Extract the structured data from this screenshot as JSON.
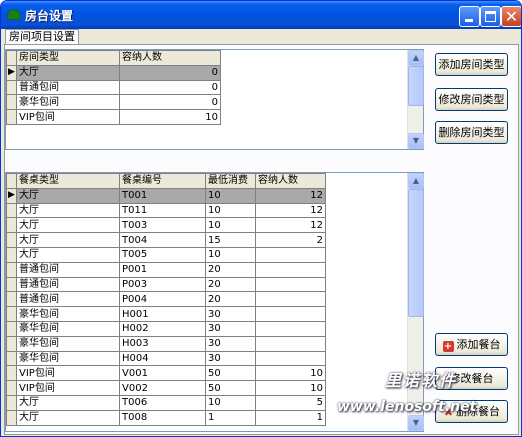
{
  "window": {
    "title": "房台设置"
  },
  "tab": {
    "label": "房间项目设置"
  },
  "room_types": {
    "columns": [
      "房间类型",
      "容纳人数"
    ],
    "rows": [
      {
        "type": "大厅",
        "capacity": "0",
        "selected": true
      },
      {
        "type": "普通包间",
        "capacity": "0"
      },
      {
        "type": "豪华包间",
        "capacity": "0"
      },
      {
        "type": "VIP包间",
        "capacity": "10"
      }
    ]
  },
  "tables": {
    "columns": [
      "餐桌类型",
      "餐桌编号",
      "最低消费",
      "容纳人数"
    ],
    "rows": [
      {
        "type": "大厅",
        "code": "T001",
        "min_spend": "10",
        "capacity": "12",
        "selected": true
      },
      {
        "type": "大厅",
        "code": "T011",
        "min_spend": "10",
        "capacity": "12"
      },
      {
        "type": "大厅",
        "code": "T003",
        "min_spend": "10",
        "capacity": "12"
      },
      {
        "type": "大厅",
        "code": "T004",
        "min_spend": "15",
        "capacity": "2"
      },
      {
        "type": "大厅",
        "code": "T005",
        "min_spend": "10",
        "capacity": ""
      },
      {
        "type": "普通包间",
        "code": "P001",
        "min_spend": "20",
        "capacity": ""
      },
      {
        "type": "普通包间",
        "code": "P003",
        "min_spend": "20",
        "capacity": ""
      },
      {
        "type": "普通包间",
        "code": "P004",
        "min_spend": "20",
        "capacity": ""
      },
      {
        "type": "豪华包间",
        "code": "H001",
        "min_spend": "30",
        "capacity": ""
      },
      {
        "type": "豪华包间",
        "code": "H002",
        "min_spend": "30",
        "capacity": ""
      },
      {
        "type": "豪华包间",
        "code": "H003",
        "min_spend": "30",
        "capacity": ""
      },
      {
        "type": "豪华包间",
        "code": "H004",
        "min_spend": "30",
        "capacity": ""
      },
      {
        "type": "VIP包间",
        "code": "V001",
        "min_spend": "50",
        "capacity": "10"
      },
      {
        "type": "VIP包间",
        "code": "V002",
        "min_spend": "50",
        "capacity": "10"
      },
      {
        "type": "大厅",
        "code": "T006",
        "min_spend": "10",
        "capacity": "5"
      },
      {
        "type": "大厅",
        "code": "T008",
        "min_spend": "1",
        "capacity": "1"
      }
    ]
  },
  "buttons": {
    "add_room_type": "添加房间类型",
    "edit_room_type": "修改房间类型",
    "delete_room_type": "删除房间类型",
    "add_table": "添加餐台",
    "edit_table": "修改餐台",
    "delete_table": "删除餐台"
  },
  "watermark": {
    "brand": "里诺软件",
    "url": "www.lenosoft.net"
  }
}
